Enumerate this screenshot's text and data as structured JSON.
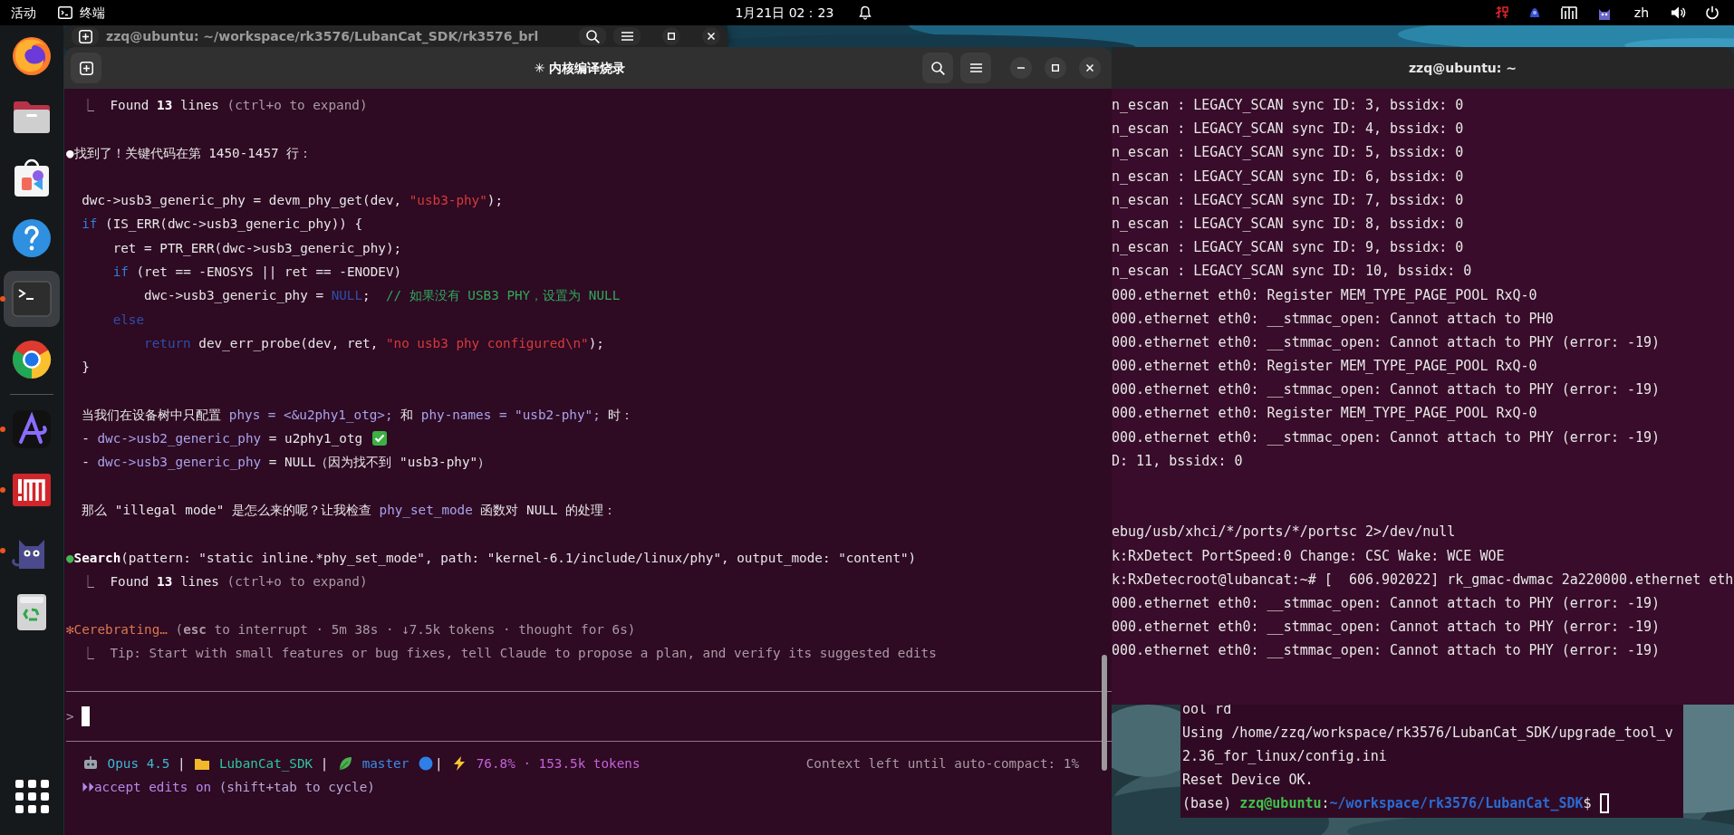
{
  "top_bar": {
    "activities": "活动",
    "app_name": "终端",
    "clock": "1月21日 02：23",
    "input_method": "zh"
  },
  "dock": {
    "items": [
      {
        "kind": "firefox",
        "running": false,
        "selected": false
      },
      {
        "kind": "files",
        "running": false,
        "selected": false
      },
      {
        "kind": "store",
        "running": false,
        "selected": false
      },
      {
        "kind": "help",
        "running": false,
        "selected": false
      },
      {
        "kind": "terminal",
        "running": true,
        "selected": true
      },
      {
        "kind": "chrome",
        "running": false,
        "selected": false
      },
      {
        "kind": "separator"
      },
      {
        "kind": "ai",
        "running": true,
        "selected": false
      },
      {
        "kind": "im",
        "running": true,
        "selected": false
      },
      {
        "kind": "cat",
        "running": true,
        "selected": false
      },
      {
        "kind": "trash",
        "running": false,
        "selected": false
      },
      {
        "kind": "grid",
        "running": false,
        "selected": false
      }
    ]
  },
  "back_window": {
    "title": "zzq@ubuntu: ~/workspace/rk3576/LubanCat_SDK/rk3576_brl"
  },
  "main_window": {
    "title": "✳ 内核编译烧录",
    "lines": [
      {
        "kind": "text",
        "segments": [
          {
            "kind": "dim",
            "text": "  ⎿  "
          },
          {
            "kind": "plain",
            "text": "Found "
          },
          {
            "kind": "bold",
            "text": "13"
          },
          {
            "kind": "plain",
            "text": " lines "
          },
          {
            "kind": "dim",
            "text": "(ctrl+o to expand)"
          }
        ]
      },
      {
        "kind": "blank"
      },
      {
        "kind": "text",
        "segments": [
          {
            "kind": "bullet",
            "text": "●"
          },
          {
            "kind": "plain",
            "text": "找到了！关键代码在第 1450-1457 行："
          }
        ]
      },
      {
        "kind": "blank"
      },
      {
        "kind": "text",
        "segments": [
          {
            "kind": "plain",
            "text": "  dwc->usb3_generic_phy = devm_phy_get(dev, "
          },
          {
            "kind": "string",
            "text": "\"usb3-phy\""
          },
          {
            "kind": "plain",
            "text": ");"
          }
        ]
      },
      {
        "kind": "text",
        "segments": [
          {
            "kind": "keyword",
            "text": "  if"
          },
          {
            "kind": "plain",
            "text": " (IS_ERR(dwc->usb3_generic_phy)) {"
          }
        ]
      },
      {
        "kind": "text",
        "segments": [
          {
            "kind": "plain",
            "text": "      ret = PTR_ERR(dwc->usb3_generic_phy);"
          }
        ]
      },
      {
        "kind": "text",
        "segments": [
          {
            "kind": "keyword",
            "text": "      if"
          },
          {
            "kind": "plain",
            "text": " (ret == -ENOSYS || ret == -ENODEV)"
          }
        ]
      },
      {
        "kind": "text",
        "segments": [
          {
            "kind": "plain",
            "text": "          dwc->usb3_generic_phy = "
          },
          {
            "kind": "keyword2",
            "text": "NULL"
          },
          {
            "kind": "plain",
            "text": ";  "
          },
          {
            "kind": "comment",
            "text": "// 如果没有 USB3 PHY，设置为 NULL"
          }
        ]
      },
      {
        "kind": "text",
        "segments": [
          {
            "kind": "keyword2",
            "text": "      else"
          }
        ]
      },
      {
        "kind": "text",
        "segments": [
          {
            "kind": "keyword2",
            "text": "          return"
          },
          {
            "kind": "plain",
            "text": " dev_err_probe(dev, ret, "
          },
          {
            "kind": "string",
            "text": "\"no usb3 phy configured\\n\""
          },
          {
            "kind": "plain",
            "text": ");"
          }
        ]
      },
      {
        "kind": "text",
        "segments": [
          {
            "kind": "plain",
            "text": "  }"
          }
        ]
      },
      {
        "kind": "blank"
      },
      {
        "kind": "text",
        "segments": [
          {
            "kind": "plain",
            "text": "  当我们在设备树中只配置 "
          },
          {
            "kind": "ident",
            "text": "phys = <&u2phy1_otg>;"
          },
          {
            "kind": "plain",
            "text": " 和 "
          },
          {
            "kind": "ident",
            "text": "phy-names = \"usb2-phy\";"
          },
          {
            "kind": "plain",
            "text": " 时："
          }
        ]
      },
      {
        "kind": "text",
        "segments": [
          {
            "kind": "plain",
            "text": "  - "
          },
          {
            "kind": "ident",
            "text": "dwc->usb2_generic_phy"
          },
          {
            "kind": "plain",
            "text": " = u2phy1_otg "
          },
          {
            "kind": "check"
          }
        ]
      },
      {
        "kind": "text",
        "segments": [
          {
            "kind": "plain",
            "text": "  - "
          },
          {
            "kind": "ident",
            "text": "dwc->usb3_generic_phy"
          },
          {
            "kind": "plain",
            "text": " = NULL（因为找不到 \"usb3-phy\"）"
          }
        ]
      },
      {
        "kind": "blank"
      },
      {
        "kind": "text",
        "segments": [
          {
            "kind": "plain",
            "text": "  那么 \"illegal mode\" 是怎么来的呢？让我检查 "
          },
          {
            "kind": "ident",
            "text": "phy_set_mode"
          },
          {
            "kind": "plain",
            "text": " 函数对 NULL 的处理："
          }
        ]
      },
      {
        "kind": "blank"
      },
      {
        "kind": "text",
        "segments": [
          {
            "kind": "done",
            "text": "●"
          },
          {
            "kind": "bold",
            "text": "Search"
          },
          {
            "kind": "plain",
            "text": "(pattern: \"static inline.*phy_set_mode\", path: \"kernel-6.1/include/linux/phy\", output_mode: \"content\")"
          }
        ]
      },
      {
        "kind": "text",
        "segments": [
          {
            "kind": "dim",
            "text": "  ⎿  "
          },
          {
            "kind": "plain",
            "text": "Found "
          },
          {
            "kind": "bold",
            "text": "13"
          },
          {
            "kind": "plain",
            "text": " lines "
          },
          {
            "kind": "dim",
            "text": "(ctrl+o to expand)"
          }
        ]
      },
      {
        "kind": "blank"
      },
      {
        "kind": "text",
        "segments": [
          {
            "kind": "orange",
            "text": "✻"
          },
          {
            "kind": "orange",
            "text": "Cerebrating…"
          },
          {
            "kind": "dim",
            "text": " ("
          },
          {
            "kind": "dimbold",
            "text": "esc"
          },
          {
            "kind": "dim",
            "text": " to interrupt · 5m 38s · ↓7.5k tokens · thought for 6s)"
          }
        ]
      },
      {
        "kind": "text",
        "segments": [
          {
            "kind": "dim",
            "text": "  ⎿  Tip: Start with small features or bug fixes, tell Claude to propose a plan, and verify its suggested edits"
          }
        ]
      }
    ],
    "prompt": {
      "symbol": ">"
    },
    "status": {
      "segments": [
        {
          "kind": "robot"
        },
        {
          "kind": "cyan",
          "text": " Opus 4.5"
        },
        {
          "kind": "plain",
          "text": " | "
        },
        {
          "kind": "folder"
        },
        {
          "kind": "teal",
          "text": " LubanCat_SDK"
        },
        {
          "kind": "plain",
          "text": " | "
        },
        {
          "kind": "leaf"
        },
        {
          "kind": "blue",
          "text": " master "
        },
        {
          "kind": "dot"
        },
        {
          "kind": "plain",
          "text": "| "
        },
        {
          "kind": "bolt"
        },
        {
          "kind": "magenta",
          "text": " 76.8% · 153.5k tokens"
        }
      ],
      "context": "Context left until auto-compact: 1%"
    },
    "mode": {
      "kind": "text",
      "segments": [
        {
          "kind": "mode",
          "text": "⏵⏵accept edits on"
        },
        {
          "kind": "mode2",
          "text": " (shift+tab to cycle)"
        }
      ]
    }
  },
  "right_window": {
    "title": "zzq@ubuntu: ~",
    "lines": [
      {
        "kind": "text",
        "text": "n_escan : LEGACY_SCAN sync ID: 3, bssidx: 0"
      },
      {
        "kind": "text",
        "text": "n_escan : LEGACY_SCAN sync ID: 4, bssidx: 0"
      },
      {
        "kind": "text",
        "text": "n_escan : LEGACY_SCAN sync ID: 5, bssidx: 0"
      },
      {
        "kind": "text",
        "text": "n_escan : LEGACY_SCAN sync ID: 6, bssidx: 0"
      },
      {
        "kind": "text",
        "text": "n_escan : LEGACY_SCAN sync ID: 7, bssidx: 0"
      },
      {
        "kind": "text",
        "text": "n_escan : LEGACY_SCAN sync ID: 8, bssidx: 0"
      },
      {
        "kind": "text",
        "text": "n_escan : LEGACY_SCAN sync ID: 9, bssidx: 0"
      },
      {
        "kind": "text",
        "text": "n_escan : LEGACY_SCAN sync ID: 10, bssidx: 0"
      },
      {
        "kind": "text",
        "text": "000.ethernet eth0: Register MEM_TYPE_PAGE_POOL RxQ-0"
      },
      {
        "kind": "text",
        "text": "000.ethernet eth0: __stmmac_open: Cannot attach to PH0"
      },
      {
        "kind": "text",
        "text": "000.ethernet eth0: __stmmac_open: Cannot attach to PHY (error: -19)"
      },
      {
        "kind": "text",
        "text": "000.ethernet eth0: Register MEM_TYPE_PAGE_POOL RxQ-0"
      },
      {
        "kind": "text",
        "text": "000.ethernet eth0: __stmmac_open: Cannot attach to PHY (error: -19)"
      },
      {
        "kind": "text",
        "text": "000.ethernet eth0: Register MEM_TYPE_PAGE_POOL RxQ-0"
      },
      {
        "kind": "text",
        "text": "000.ethernet eth0: __stmmac_open: Cannot attach to PHY (error: -19)"
      },
      {
        "kind": "text",
        "text": "D: 11, bssidx: 0"
      },
      {
        "kind": "blank"
      },
      {
        "kind": "blank"
      },
      {
        "kind": "text",
        "text": "ebug/usb/xhci/*/ports/*/portsc 2>/dev/null"
      },
      {
        "kind": "text",
        "text": "k:RxDetect PortSpeed:0 Change: CSC Wake: WCE WOE"
      },
      {
        "kind": "text",
        "text": "k:RxDetecroot@lubancat:~# [  606.902022] rk_gmac-dwmac 2a220000.ethernet eth"
      },
      {
        "kind": "text",
        "text": "000.ethernet eth0: __stmmac_open: Cannot attach to PHY (error: -19)"
      },
      {
        "kind": "text",
        "text": "000.ethernet eth0: __stmmac_open: Cannot attach to PHY (error: -19)"
      },
      {
        "kind": "text",
        "text": "000.ethernet eth0: __stmmac_open: Cannot attach to PHY (error: -19)"
      }
    ]
  },
  "small_window": {
    "lines": [
      {
        "kind": "text",
        "segments": [
          {
            "kind": "plain",
            "text": "ool rd"
          }
        ]
      },
      {
        "kind": "text",
        "segments": [
          {
            "kind": "plain",
            "text": "Using /home/zzq/workspace/rk3576/LubanCat_SDK/upgrade_tool_v"
          }
        ]
      },
      {
        "kind": "text",
        "segments": [
          {
            "kind": "plain",
            "text": "2.36_for_linux/config.ini"
          }
        ]
      },
      {
        "kind": "text",
        "segments": [
          {
            "kind": "plain",
            "text": "Reset Device OK."
          }
        ]
      },
      {
        "kind": "text",
        "segments": [
          {
            "kind": "plain",
            "text": "(base) "
          },
          {
            "kind": "user",
            "text": "zzq@ubuntu"
          },
          {
            "kind": "plain",
            "text": ":"
          },
          {
            "kind": "path",
            "text": "~/workspace/rk3576/LubanCat_SDK"
          },
          {
            "kind": "plain",
            "text": "$ "
          },
          {
            "kind": "cursor_outline"
          }
        ]
      }
    ]
  }
}
